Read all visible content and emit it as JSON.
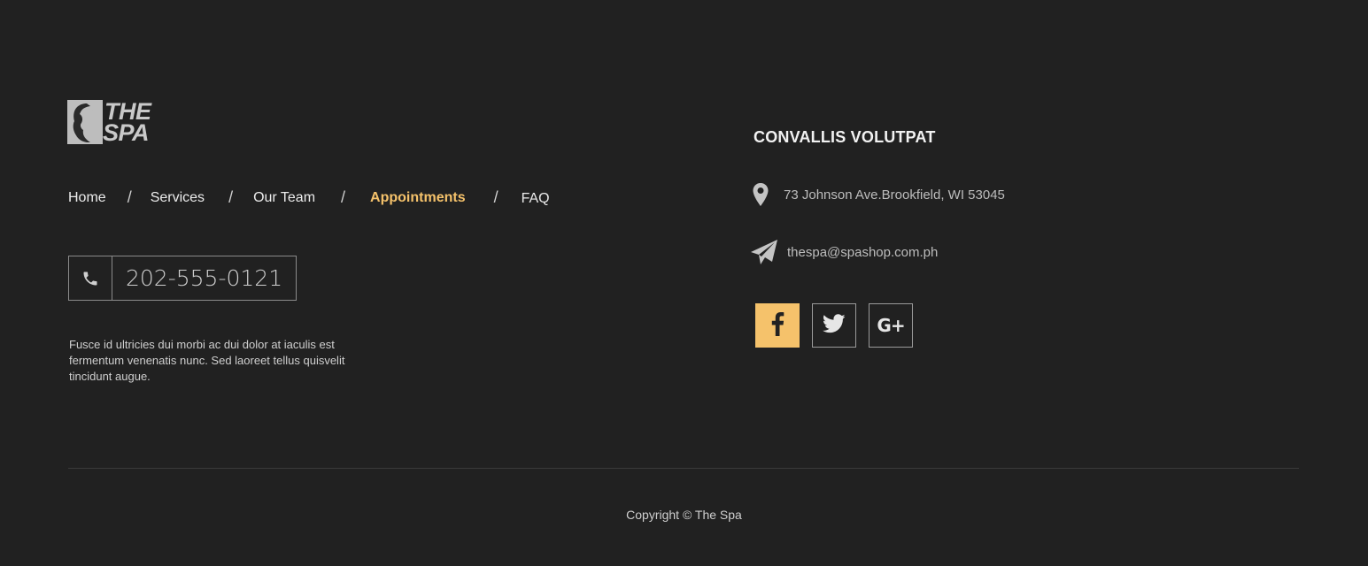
{
  "brand": {
    "logo_line1": "THE",
    "logo_line2": "SPA"
  },
  "nav": {
    "items": [
      {
        "label": "Home",
        "active": false
      },
      {
        "label": "Services",
        "active": false
      },
      {
        "label": "Our Team",
        "active": false
      },
      {
        "label": "Appointments",
        "active": true
      },
      {
        "label": "FAQ",
        "active": false
      }
    ],
    "separator": "/"
  },
  "phone": {
    "number": "202-555-0121",
    "icon": "phone-icon"
  },
  "description": "Fusce id ultricies dui morbi ac dui dolor at iaculis est fermentum venenatis nunc. Sed laoreet tellus quisvelit tincidunt augue.",
  "contact": {
    "title": "CONVALLIS VOLUTPAT",
    "address": "73 Johnson Ave.Brookfield, WI 53045",
    "address_icon": "map-pin-icon",
    "email": "thespa@spashop.com.ph",
    "email_icon": "paper-plane-icon"
  },
  "social": [
    {
      "name": "facebook",
      "icon": "facebook-icon",
      "glyph": "f"
    },
    {
      "name": "twitter",
      "icon": "twitter-icon",
      "glyph": ""
    },
    {
      "name": "google-plus",
      "icon": "google-plus-icon",
      "glyph": "G+"
    }
  ],
  "copyright": "Copyright © The Spa",
  "colors": {
    "background": "#212121",
    "accent": "#f5c26b",
    "text": "#e0e0e0",
    "border": "#8a8a8a"
  }
}
